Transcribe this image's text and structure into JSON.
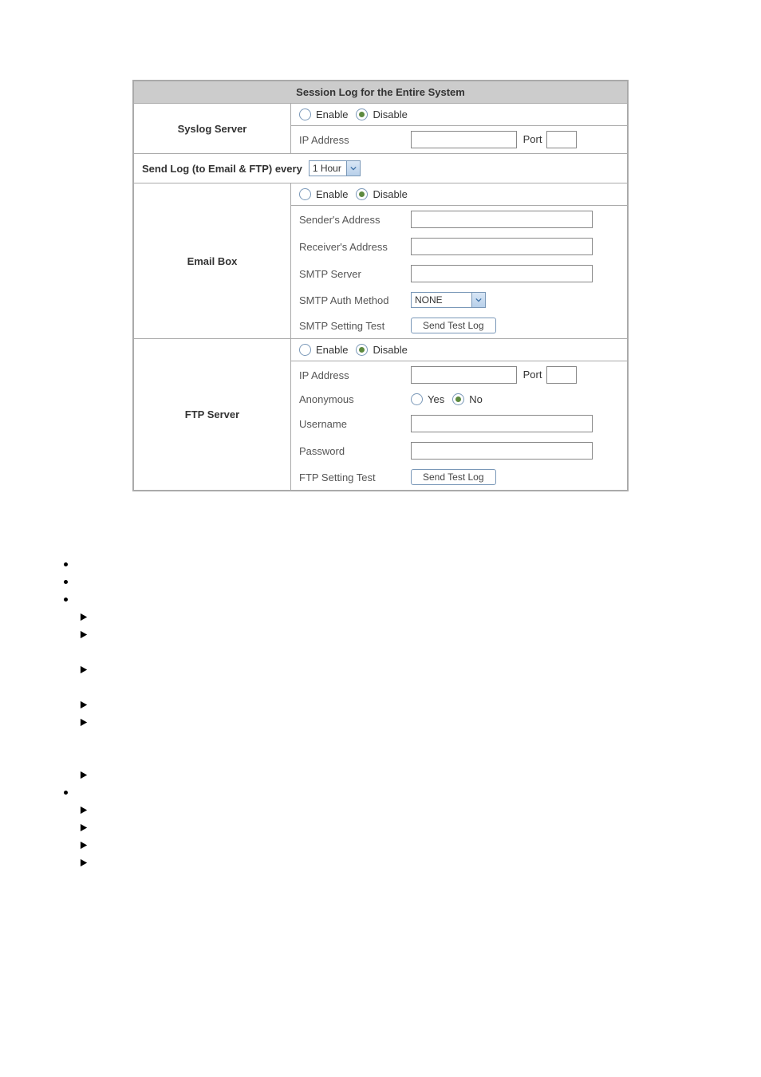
{
  "title": "Session Log for the Entire System",
  "radio": {
    "enable": "Enable",
    "disable": "Disable",
    "yes": "Yes",
    "no": "No"
  },
  "syslog": {
    "label": "Syslog Server",
    "ip_label": "IP Address",
    "port_label": "Port"
  },
  "sendlog": {
    "label": "Send Log (to Email & FTP) every",
    "value": "1 Hour"
  },
  "email": {
    "label": "Email Box",
    "sender": "Sender's Address",
    "receiver": "Receiver's Address",
    "smtp_server": "SMTP Server",
    "smtp_auth": "SMTP Auth Method",
    "smtp_auth_value": "NONE",
    "smtp_test": "SMTP Setting Test",
    "test_btn": "Send Test Log"
  },
  "ftp": {
    "label": "FTP Server",
    "ip_label": "IP Address",
    "port_label": "Port",
    "anon": "Anonymous",
    "user": "Username",
    "pass": "Password",
    "test": "FTP Setting Test",
    "test_btn": "Send Test Log"
  }
}
